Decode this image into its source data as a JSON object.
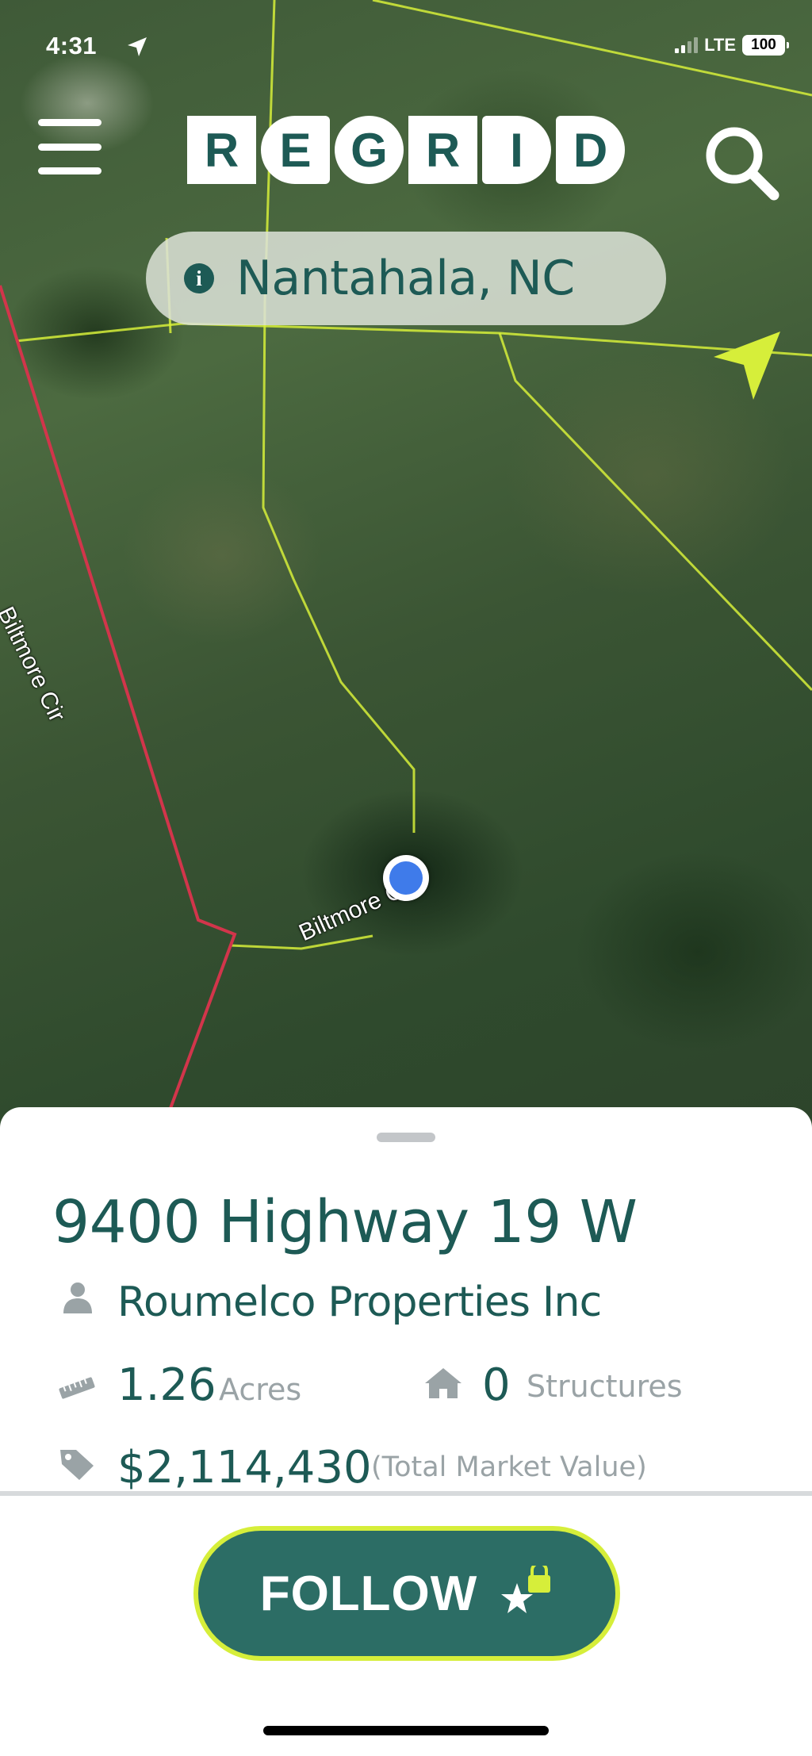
{
  "status_bar": {
    "time": "4:31",
    "network": "LTE",
    "battery": "100"
  },
  "header": {
    "logo_letters": [
      "R",
      "E",
      "G",
      "R",
      "I",
      "D"
    ],
    "location": "Nantahala, NC"
  },
  "map": {
    "road_labels": [
      "Biltmore Cir",
      "Biltmore Cir"
    ],
    "colors": {
      "parcel_line": "#d6ee3a",
      "road_line": "#d2354b",
      "user_dot": "#3f7bea"
    }
  },
  "parcel": {
    "address": "9400 Highway 19 W",
    "owner": "Roumelco Properties Inc",
    "acres_value": "1.26",
    "acres_label": "Acres",
    "structures_value": "0",
    "structures_label": "Structures",
    "market_value": "$2,114,430",
    "market_value_label": "(Total Market Value)"
  },
  "actions": {
    "follow_label": "FOLLOW"
  },
  "icons": {
    "menu": "hamburger-menu-icon",
    "search": "search-icon",
    "info": "info-icon",
    "compass": "location-arrow-icon",
    "owner": "person-icon",
    "acres": "ruler-icon",
    "structures": "home-icon",
    "value": "tag-icon",
    "follow": "star-lock-icon"
  },
  "theme": {
    "brand": "#1d5a55",
    "accent": "#d6ee3a",
    "follow_bg": "#2c6d65"
  }
}
